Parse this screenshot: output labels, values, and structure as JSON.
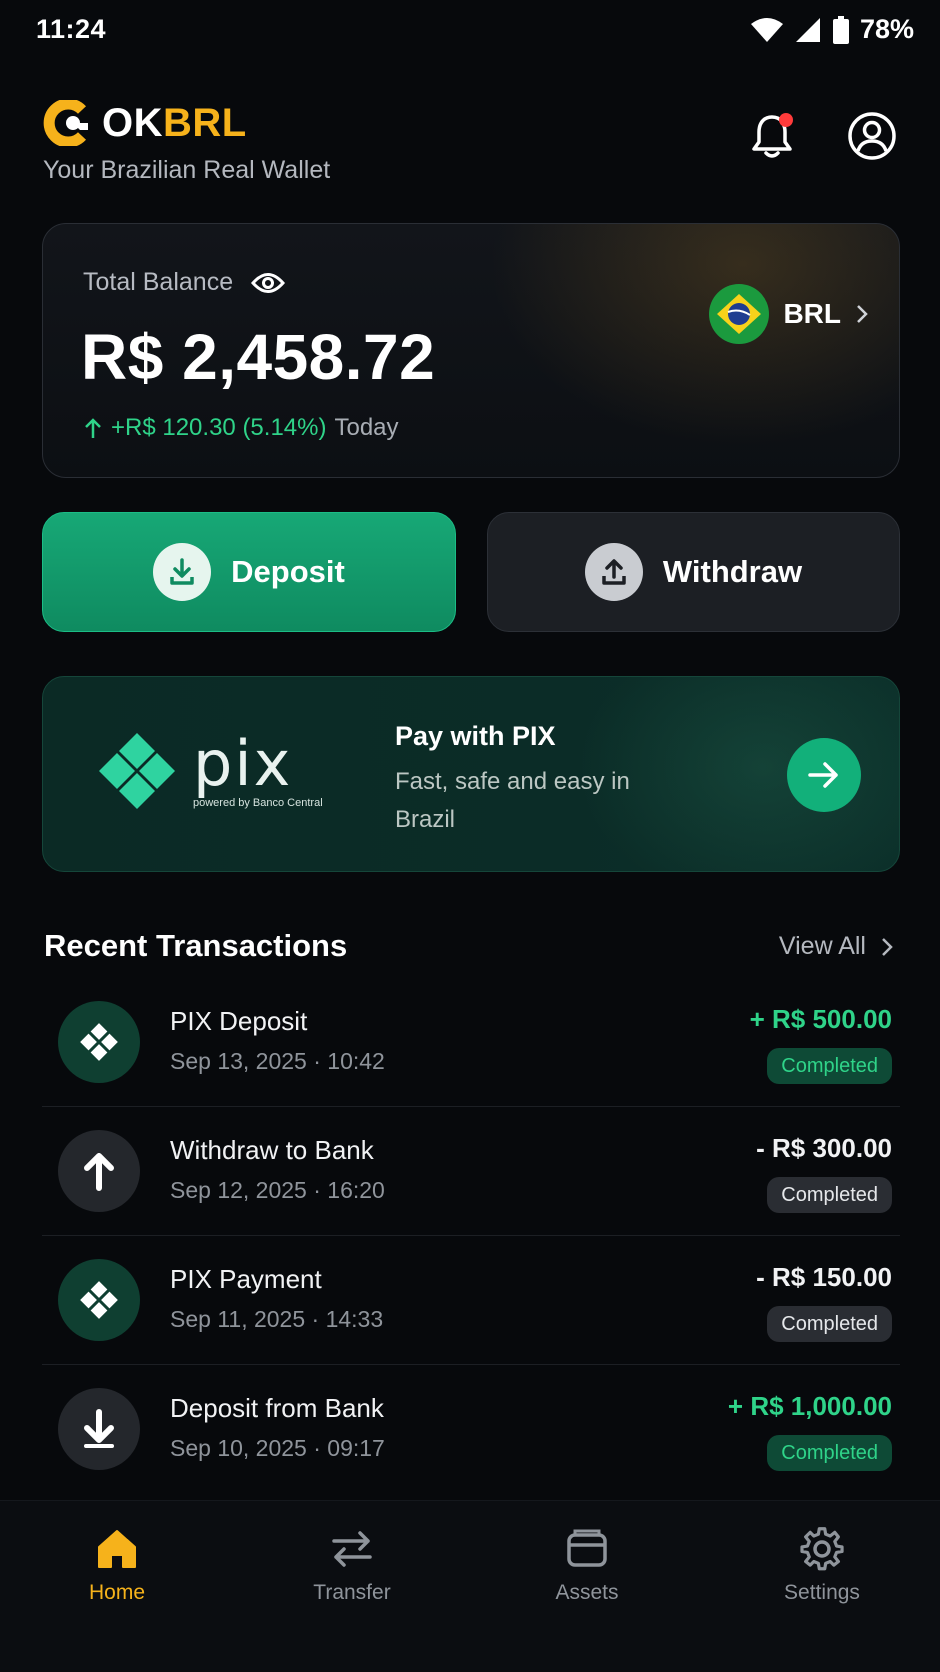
{
  "status_bar": {
    "time": "11:24",
    "battery": "78%"
  },
  "header": {
    "brand_part1": "OK",
    "brand_part2": "BRL",
    "tagline": "Your Brazilian Real Wallet",
    "icons": {
      "notifications": "bell-icon",
      "profile": "user-circle-icon"
    }
  },
  "balance": {
    "label": "Total Balance",
    "amount": "R$ 2,458.72",
    "change": "+R$ 120.30 (5.14%)",
    "change_period": "Today",
    "currency": "BRL"
  },
  "actions": {
    "deposit": "Deposit",
    "withdraw": "Withdraw"
  },
  "pix": {
    "logo_text": "pix",
    "powered_by": "powered by Banco Central",
    "title": "Pay with PIX",
    "description": "Fast, safe and easy in Brazil"
  },
  "transactions": {
    "title": "Recent Transactions",
    "view_all": "View All",
    "items": [
      {
        "title": "PIX Deposit",
        "date": "Sep 13, 2025 · 10:42",
        "amount": "+ R$ 500.00",
        "status": "Completed",
        "icon": "pix-icon"
      },
      {
        "title": "Withdraw to Bank",
        "date": "Sep 12, 2025 · 16:20",
        "amount": "- R$ 300.00",
        "status": "Completed",
        "icon": "arrow-up-icon"
      },
      {
        "title": "PIX Payment",
        "date": "Sep 11, 2025 · 14:33",
        "amount": "- R$ 150.00",
        "status": "Completed",
        "icon": "pix-icon"
      },
      {
        "title": "Deposit from Bank",
        "date": "Sep 10, 2025 · 09:17",
        "amount": "+ R$ 1,000.00",
        "status": "Completed",
        "icon": "arrow-down-icon"
      }
    ]
  },
  "nav": {
    "home": "Home",
    "transfer": "Transfer",
    "assets": "Assets",
    "settings": "Settings"
  },
  "colors": {
    "accent": "#f6b21b",
    "positive": "#2fd389",
    "deposit_button": "#12a070",
    "background": "#07090c"
  }
}
